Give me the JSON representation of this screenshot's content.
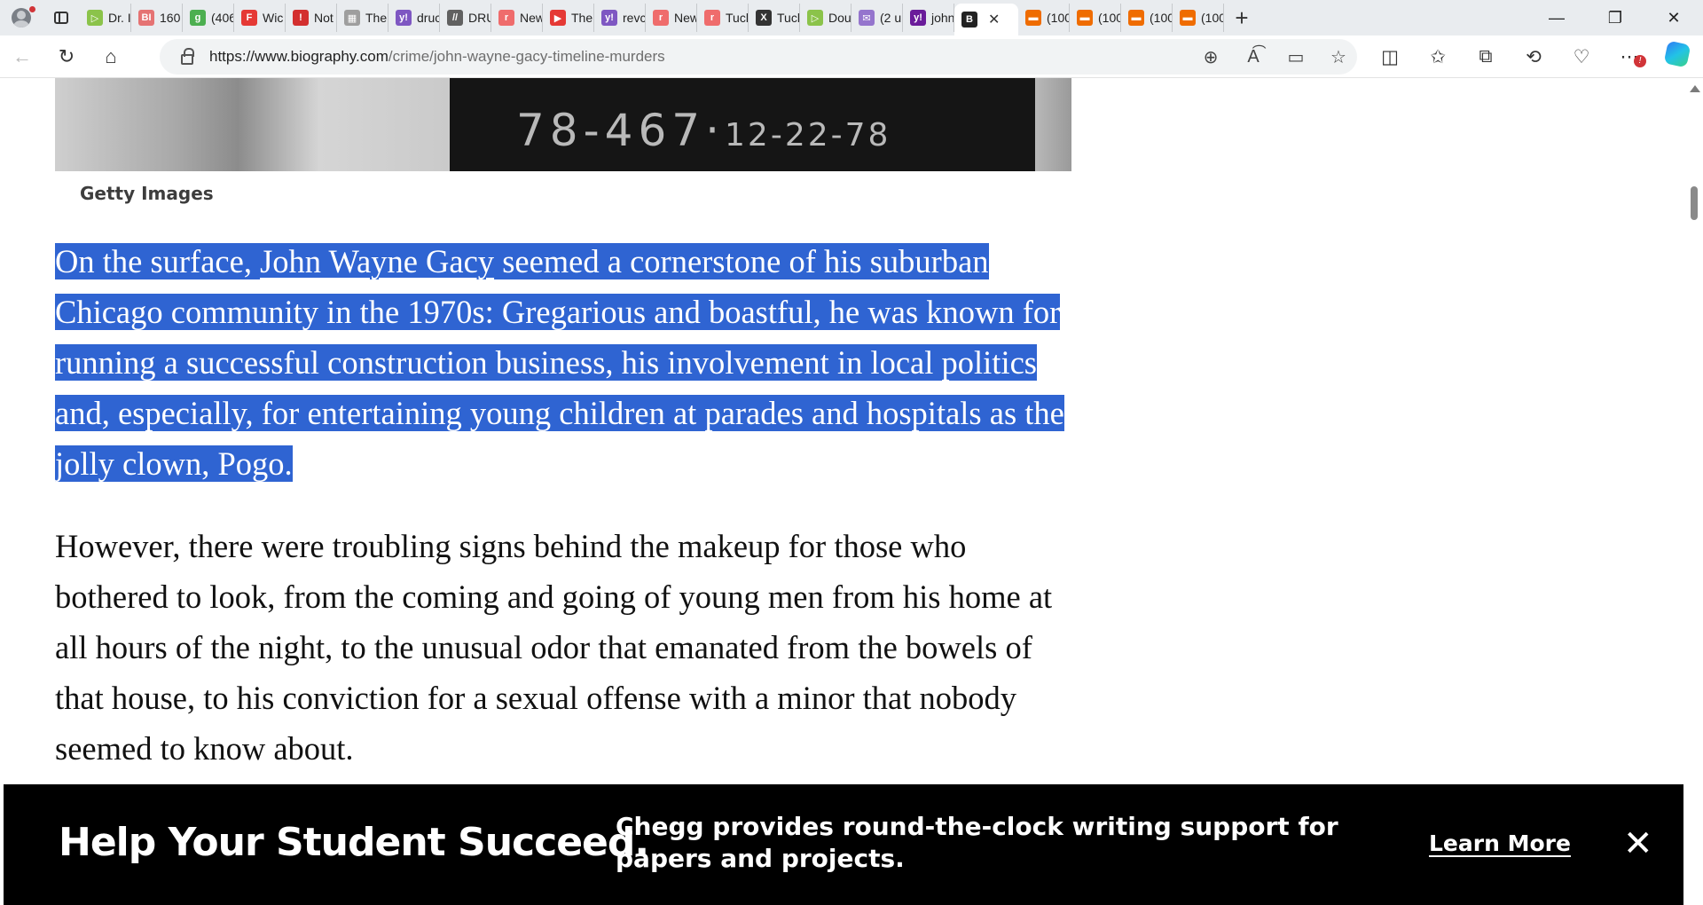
{
  "browser": {
    "tabs": [
      {
        "label": "Dr. I",
        "icon": "play-icon",
        "color": "#8bc34a"
      },
      {
        "label": "160",
        "icon": "bi-icon",
        "color": "#e57373"
      },
      {
        "label": "(406",
        "icon": "g-icon",
        "color": "#4caf50"
      },
      {
        "label": "Wic",
        "icon": "flipboard-icon",
        "color": "#e53935"
      },
      {
        "label": "Not",
        "icon": "alert-icon",
        "color": "#d32f2f"
      },
      {
        "label": "The",
        "icon": "grid-icon",
        "color": "#9e9e9e"
      },
      {
        "label": "druc",
        "icon": "yahoo-icon",
        "color": "#7e57c2"
      },
      {
        "label": "DRU",
        "icon": "slash-icon",
        "color": "#616161"
      },
      {
        "label": "New",
        "icon": "r-icon",
        "color": "#ef6c6c"
      },
      {
        "label": "The",
        "icon": "youtube-icon",
        "color": "#e53935"
      },
      {
        "label": "revc",
        "icon": "yahoo-icon",
        "color": "#7e57c2"
      },
      {
        "label": "New",
        "icon": "r-icon",
        "color": "#ef6c6c"
      },
      {
        "label": "Tucl",
        "icon": "r-icon",
        "color": "#ef6c6c"
      },
      {
        "label": "Tucl",
        "icon": "x-icon",
        "color": "#333333"
      },
      {
        "label": "Dou",
        "icon": "play-icon",
        "color": "#8bc34a"
      },
      {
        "label": "(2 u",
        "icon": "mail-icon",
        "color": "#9575cd"
      },
      {
        "label": "john",
        "icon": "yahoo-icon",
        "color": "#6a1b9a"
      },
      {
        "label": "B",
        "icon": "biography-icon",
        "color": "#222222",
        "active": true
      },
      {
        "label": "(100",
        "icon": "bookmark-icon",
        "color": "#ef6c00"
      },
      {
        "label": "(100",
        "icon": "bookmark-icon",
        "color": "#ef6c00"
      },
      {
        "label": "(100",
        "icon": "bookmark-icon",
        "color": "#ef6c00"
      },
      {
        "label": "(100",
        "icon": "bookmark-icon",
        "color": "#ef6c00"
      }
    ],
    "url_host": "https://www.biography.com",
    "url_path": "/crime/john-wayne-gacy-timeline-murders"
  },
  "photo": {
    "number_main": "78-467",
    "number_date": "12-22-78",
    "caption": "Getty Images"
  },
  "article": {
    "p1_before": "On the surface, ",
    "p1_link": "John Wayne Gacy",
    "p1_after": " seemed a cornerstone of his suburban Chicago community in the 1970s: Gregarious and boastful, he was known for running a successful construction business, his involvement in local politics and, especially, for entertaining young children at parades and hospitals as the jolly clown, Pogo.",
    "p2": "However, there were troubling signs behind the makeup for those who bothered to look, from the coming and going of young men from his home at all hours of the night, to the unusual odor that emanated from the bowels of that house, to his conviction for a sexual offense with a minor that nobody seemed to know about."
  },
  "ad": {
    "headline": "Help Your Student Succeed.",
    "body": "Chegg provides round-the-clock writing support for papers and projects.",
    "cta": "Learn More",
    "close": "✕"
  }
}
